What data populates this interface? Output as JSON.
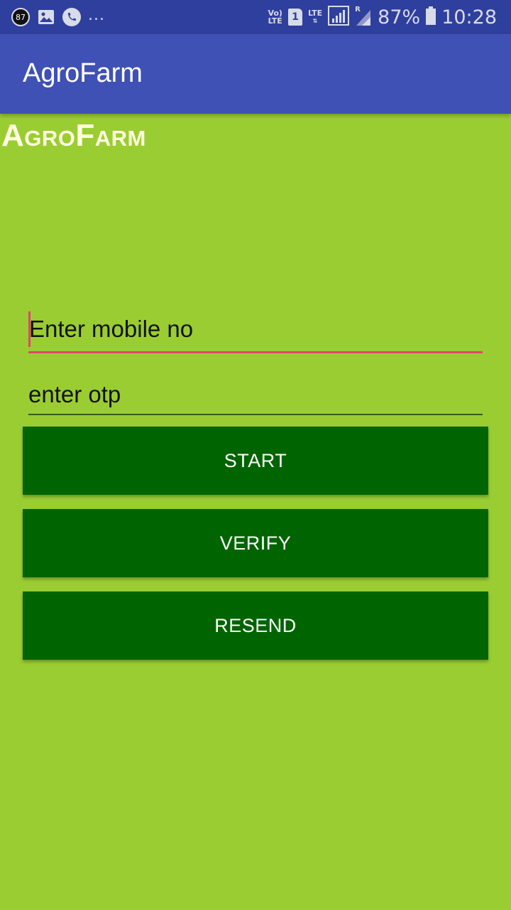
{
  "status_bar": {
    "notif_badge": "87",
    "overflow": "...",
    "volte_top": "Vo)",
    "volte_bottom": "LTE",
    "sim": "1",
    "lte": "LTE",
    "roaming": "R",
    "battery": "87%",
    "time": "10:28",
    "icons": [
      "image-icon",
      "phone-icon",
      "signal-icon",
      "battery-icon"
    ]
  },
  "app_bar": {
    "title": "AgroFarm"
  },
  "brand": {
    "logo_text": "AgroFarm"
  },
  "form": {
    "mobile_placeholder": "Enter mobile no",
    "otp_placeholder": "enter otp"
  },
  "buttons": {
    "start": "START",
    "verify": "VERIFY",
    "resend": "RESEND"
  },
  "colors": {
    "background": "#9acd32",
    "app_bar": "#3f51b5",
    "status_bar": "#2f3f9e",
    "button": "#006400",
    "accent": "#e2466a"
  }
}
